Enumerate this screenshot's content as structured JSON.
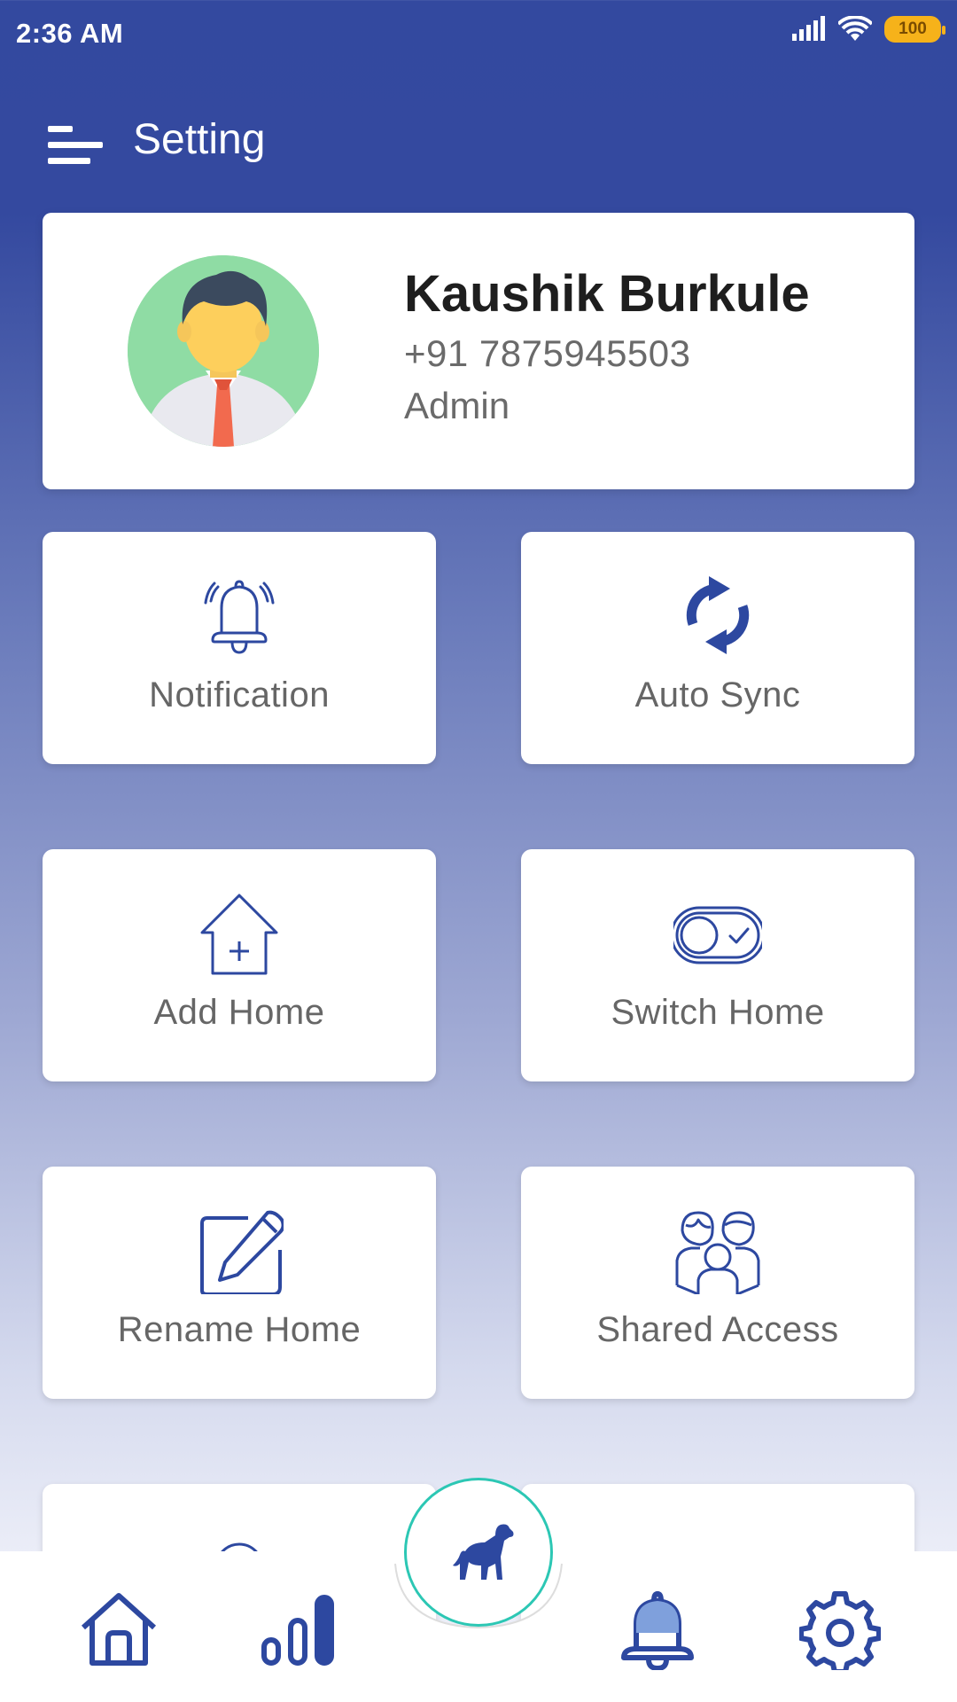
{
  "status_bar": {
    "time": "2:36 AM",
    "battery": "100"
  },
  "header": {
    "title": "Setting",
    "menu_icon": "menu-icon"
  },
  "profile": {
    "name": "Kaushik Burkule",
    "phone": "+91 7875945503",
    "role": "Admin",
    "avatar_icon": "user-avatar"
  },
  "tiles": [
    {
      "label": "Notification",
      "icon": "bell-ringing-icon"
    },
    {
      "label": "Auto Sync",
      "icon": "sync-icon"
    },
    {
      "label": "Add Home",
      "icon": "add-home-icon"
    },
    {
      "label": "Switch Home",
      "icon": "toggle-switch-icon"
    },
    {
      "label": "Rename Home",
      "icon": "edit-icon"
    },
    {
      "label": "Shared Access",
      "icon": "users-icon"
    }
  ],
  "bottom_nav": {
    "items": [
      "home-icon",
      "stats-icon",
      "dog-icon",
      "bell-icon",
      "settings-icon"
    ]
  },
  "colors": {
    "primary": "#33499f",
    "accent": "#2cc7b4",
    "icon": "#2d48a0"
  }
}
